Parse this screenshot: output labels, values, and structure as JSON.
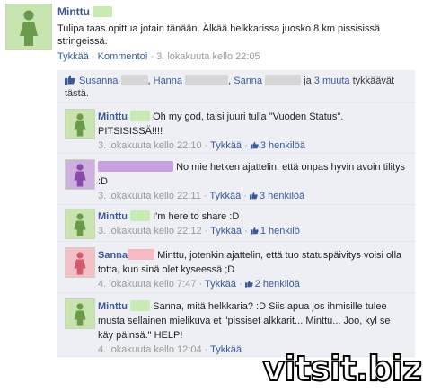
{
  "post": {
    "author": "Minttu",
    "text": "Tulipa taas opittua jotain tänään. Älkää helkkarissa juosko 8 km pissisissä stringeissä.",
    "like_label": "Tykkää",
    "comment_label": "Kommentoi",
    "separator": "·",
    "timestamp": "3. lokakuuta kello 22:05"
  },
  "likes": {
    "names": [
      "Susanna",
      "Hanna",
      "Sanna"
    ],
    "and_label": "ja",
    "others": "3 muuta",
    "suffix": "tykkäävät tästä."
  },
  "comments": [
    {
      "author": "Minttu",
      "text": "Oh my god, taisi juuri tulla \"Vuoden Status\". PITSISISSÄ!!!!",
      "timestamp": "3. lokakuuta kello 22:10",
      "like_label": "Tykkää",
      "likes": "3 henkilöä",
      "avatar_color": "#6a9a4a"
    },
    {
      "author": "",
      "text": "No mie hetken ajattelin, että onpas hyvin avoin tilitys :D",
      "timestamp": "3. lokakuuta kello 22:11",
      "like_label": "Tykkää",
      "likes": "3 henkilöä",
      "avatar_color": "#8a4aa8"
    },
    {
      "author": "Minttu",
      "text": "I'm here to share :D",
      "timestamp": "3. lokakuuta kello 22:12",
      "like_label": "Tykkää",
      "likes": "1 henkilö",
      "avatar_color": "#6a9a4a"
    },
    {
      "author": "Sanna",
      "text": "Minttu, jotenkin ajattelin, että tuo statuspäivitys voisi olla totta, kun sinä olet kyseessä ;D",
      "timestamp": "4. lokakuuta kello 7:47",
      "like_label": "Tykkää",
      "likes": "2 henkilöä",
      "avatar_color": "#d25a6a"
    },
    {
      "author": "Minttu",
      "text": "Sanna, mitä helkkaria? :D Siis apua jos ihmisille tulee musta sellainen mielikuva et \"pissiset alkkarit... Minttu... Joo, kyl se käy päinsä.\" HELP!",
      "timestamp": "4. lokakuuta kello 12:04",
      "like_label": "Tykkää",
      "likes": "",
      "avatar_color": "#6a9a4a"
    }
  ],
  "watermark": "vitsit.biz",
  "colors": {
    "link": "#3b5998",
    "comment_bg": "#edeff4",
    "avatar_bg_green": "#c8e4b0",
    "avatar_bg_purple": "#cdb0e0",
    "avatar_bg_pink": "#f4c0c8"
  }
}
